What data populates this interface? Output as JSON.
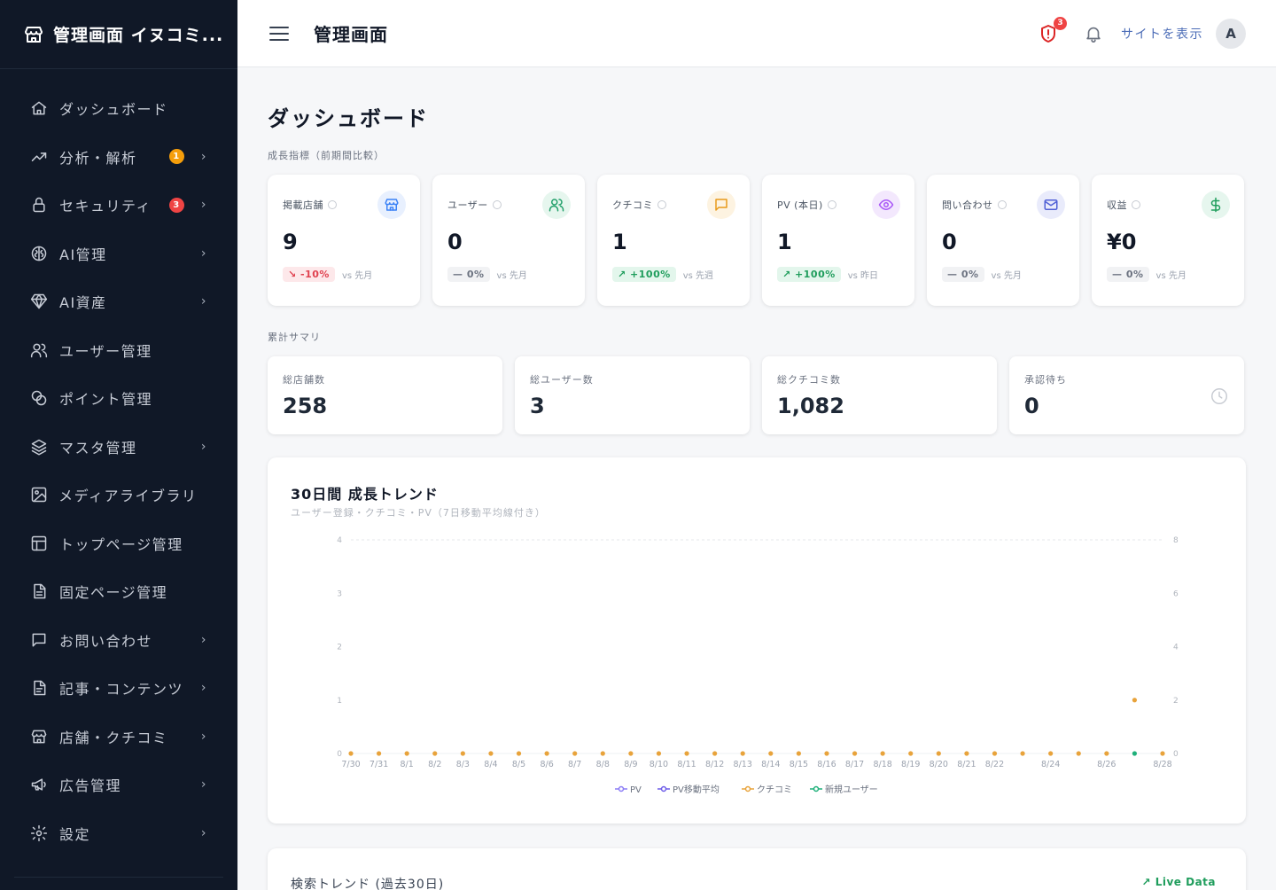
{
  "brand": {
    "title": "管理画面 イヌコミ..."
  },
  "sidebar": {
    "items": [
      {
        "label": "ダッシュボード",
        "icon": "home-icon",
        "badge": "",
        "chevron": false
      },
      {
        "label": "分析・解析",
        "icon": "trend-up-icon",
        "badge": "1",
        "badge_color": "#f59e0b",
        "chevron": true
      },
      {
        "label": "セキュリティ",
        "icon": "lock-icon",
        "badge": "3",
        "badge_color": "#ef4444",
        "chevron": true
      },
      {
        "label": "AI管理",
        "icon": "ai-brain-icon",
        "badge": "",
        "chevron": true
      },
      {
        "label": "AI資産",
        "icon": "gem-icon",
        "badge": "",
        "chevron": true
      },
      {
        "label": "ユーザー管理",
        "icon": "users-icon",
        "badge": "",
        "chevron": false
      },
      {
        "label": "ポイント管理",
        "icon": "coins-icon",
        "badge": "",
        "chevron": false
      },
      {
        "label": "マスタ管理",
        "icon": "layers-icon",
        "badge": "",
        "chevron": true
      },
      {
        "label": "メディアライブラリ",
        "icon": "image-icon",
        "badge": "",
        "chevron": false
      },
      {
        "label": "トップページ管理",
        "icon": "layout-icon",
        "badge": "",
        "chevron": false
      },
      {
        "label": "固定ページ管理",
        "icon": "file-icon",
        "badge": "",
        "chevron": false
      },
      {
        "label": "お問い合わせ",
        "icon": "message-icon",
        "badge": "",
        "chevron": true
      },
      {
        "label": "記事・コンテンツ",
        "icon": "document-icon",
        "badge": "",
        "chevron": true
      },
      {
        "label": "店舗・クチコミ",
        "icon": "store-icon",
        "badge": "",
        "chevron": true
      },
      {
        "label": "広告管理",
        "icon": "megaphone-icon",
        "badge": "",
        "chevron": true
      },
      {
        "label": "設定",
        "icon": "gear-icon",
        "badge": "",
        "chevron": true
      }
    ]
  },
  "header": {
    "title": "管理画面",
    "alert_count": "3",
    "site_link": "サイトを表示",
    "avatar": "A"
  },
  "main": {
    "page_title": "ダッシュボード",
    "growth_label": "成長指標（前期間比較）",
    "summary_label": "累計サマリ"
  },
  "kpis": [
    {
      "title": "掲載店舗",
      "value": "9",
      "change": "-10%",
      "trend": "neg",
      "vs": "vs 先月",
      "icon": "store-icon",
      "icon_color": "#3b82f6",
      "icon_bg": "#e8f0fe"
    },
    {
      "title": "ユーザー",
      "value": "0",
      "change": "0%",
      "trend": "neu",
      "vs": "vs 先月",
      "icon": "users-icon",
      "icon_color": "#22a06b",
      "icon_bg": "#e6f6ee"
    },
    {
      "title": "クチコミ",
      "value": "1",
      "change": "+100%",
      "trend": "pos",
      "vs": "vs 先週",
      "icon": "message-icon",
      "icon_color": "#e89a1a",
      "icon_bg": "#fdf3e1"
    },
    {
      "title": "PV (本日)",
      "value": "1",
      "change": "+100%",
      "trend": "pos",
      "vs": "vs 昨日",
      "icon": "eye-icon",
      "icon_color": "#a855f7",
      "icon_bg": "#f3e8fd"
    },
    {
      "title": "問い合わせ",
      "value": "0",
      "change": "0%",
      "trend": "neu",
      "vs": "vs 先月",
      "icon": "mail-icon",
      "icon_color": "#4f5fd6",
      "icon_bg": "#e9ebfb"
    },
    {
      "title": "収益",
      "value": "¥0",
      "change": "0%",
      "trend": "neu",
      "vs": "vs 先月",
      "icon": "dollar-icon",
      "icon_color": "#1f9d5c",
      "icon_bg": "#e6f6ee"
    }
  ],
  "summaries": [
    {
      "title": "総店舗数",
      "value": "258"
    },
    {
      "title": "総ユーザー数",
      "value": "3"
    },
    {
      "title": "総クチコミ数",
      "value": "1,082"
    },
    {
      "title": "承認待ち",
      "value": "0"
    }
  ],
  "chart_data": {
    "type": "line",
    "title": "30日間 成長トレンド",
    "subtitle": "ユーザー登録・クチコミ・PV（7日移動平均線付き）",
    "x": [
      "7/30",
      "7/31",
      "8/1",
      "8/2",
      "8/3",
      "8/4",
      "8/5",
      "8/6",
      "8/7",
      "8/8",
      "8/9",
      "8/10",
      "8/11",
      "8/12",
      "8/13",
      "8/14",
      "8/15",
      "8/16",
      "8/17",
      "8/18",
      "8/19",
      "8/20",
      "8/21",
      "8/22",
      "8/23",
      "8/24",
      "8/25",
      "8/26",
      "8/27",
      "8/28"
    ],
    "x_tick_labels": [
      "7/30",
      "7/31",
      "8/1",
      "8/2",
      "8/3",
      "8/4",
      "8/5",
      "8/6",
      "8/7",
      "8/8",
      "8/9",
      "8/10",
      "8/11",
      "8/12",
      "8/13",
      "8/14",
      "8/15",
      "8/16",
      "8/17",
      "8/18",
      "8/19",
      "8/20",
      "8/21",
      "8/22",
      "",
      "8/24",
      "",
      "8/26",
      "",
      "8/28"
    ],
    "y_left_ticks": [
      "0",
      "1",
      "2",
      "3",
      "4"
    ],
    "y_right_ticks": [
      "0",
      "2",
      "4",
      "6",
      "8"
    ],
    "ylim_left": [
      0,
      4
    ],
    "ylim_right": [
      0,
      8
    ],
    "series": [
      {
        "name": "PV",
        "color": "#8b7cf6",
        "values": [
          0,
          0,
          0,
          0,
          0,
          0,
          0,
          0,
          0,
          0,
          0,
          0,
          0,
          0,
          0,
          0,
          0,
          0,
          0,
          0,
          0,
          0,
          0,
          0,
          0,
          0,
          0,
          0,
          0,
          0
        ]
      },
      {
        "name": "PV移動平均",
        "color": "#6d5ce8",
        "values": [
          0,
          0,
          0,
          0,
          0,
          0,
          0,
          0,
          0,
          0,
          0,
          0,
          0,
          0,
          0,
          0,
          0,
          0,
          0,
          0,
          0,
          0,
          0,
          0,
          0,
          0,
          0,
          0,
          0,
          0
        ]
      },
      {
        "name": "クチコミ",
        "color": "#e8a33b",
        "values": [
          0,
          0,
          0,
          0,
          0,
          0,
          0,
          0,
          0,
          0,
          0,
          0,
          0,
          0,
          0,
          0,
          0,
          0,
          0,
          0,
          0,
          0,
          0,
          0,
          0,
          0,
          0,
          0,
          1,
          0
        ]
      },
      {
        "name": "新規ユーザー",
        "color": "#1fb07a",
        "values": [
          0,
          0,
          0,
          0,
          0,
          0,
          0,
          0,
          0,
          0,
          0,
          0,
          0,
          0,
          0,
          0,
          0,
          0,
          0,
          0,
          0,
          0,
          0,
          0,
          0,
          0,
          0,
          0,
          0,
          0
        ]
      }
    ],
    "grid": true,
    "legend": "bottom"
  },
  "search_card": {
    "title": "検索トレンド (過去30日)",
    "live": "Live Data"
  }
}
